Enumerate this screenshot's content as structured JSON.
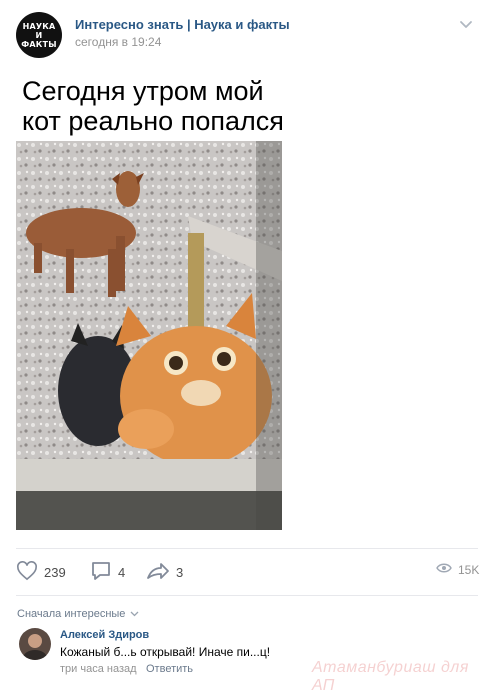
{
  "post": {
    "group_logo_text": "НАУКА И ФАКТЫ",
    "group_name": "Интересно знать | Наука и факты",
    "time": "сегодня в 19:24",
    "text_line1": "Сегодня утром мой",
    "text_line2": "кот реально попался"
  },
  "actions": {
    "likes": "239",
    "comments": "4",
    "shares": "3",
    "views": "15K"
  },
  "comments_section": {
    "sort_label": "Сначала интересные",
    "comment": {
      "author": "Алексей Здиров",
      "text": "Кожаный б...ь открывай! Иначе пи...ц!",
      "time": "три часа назад",
      "reply_label": "Ответить"
    }
  },
  "watermark": "Атаманбуриаш для АП",
  "icons": {
    "more": "chevron-down-icon",
    "like": "heart-icon",
    "comment": "comment-bubble-icon",
    "share": "share-arrow-icon",
    "views": "eye-icon"
  },
  "colors": {
    "link": "#2a5885",
    "secondary_text": "#939393",
    "divider": "#e7e8ec"
  }
}
